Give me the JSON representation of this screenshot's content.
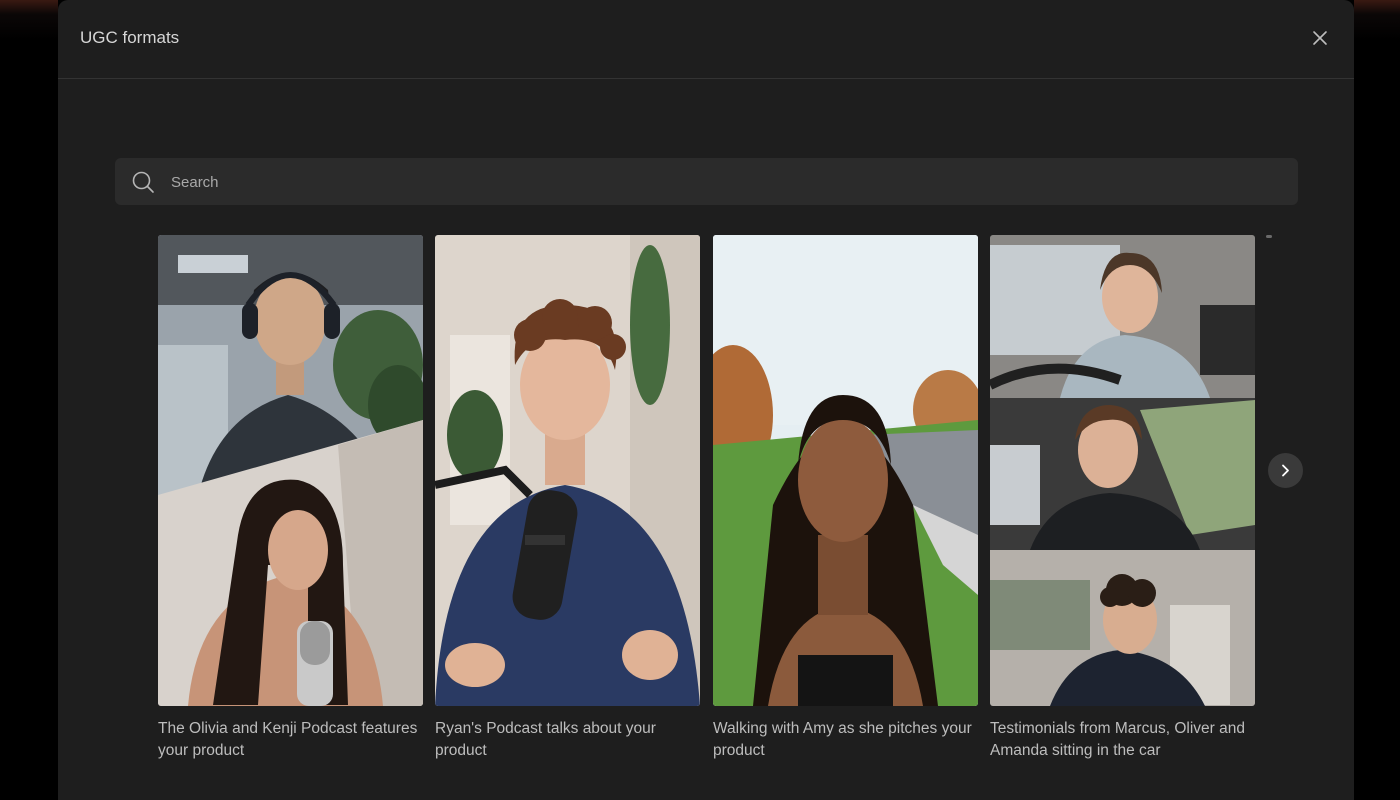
{
  "modal": {
    "title": "UGC formats",
    "close_icon": "close-icon"
  },
  "search": {
    "placeholder": "Search",
    "value": "",
    "icon": "search-icon"
  },
  "carousel": {
    "next_icon": "chevron-right-icon",
    "cards": [
      {
        "caption": "The Olivia and Kenji Podcast features your product"
      },
      {
        "caption": "Ryan's Podcast talks about your product"
      },
      {
        "caption": "Walking with Amy as she pitches your product"
      },
      {
        "caption": "Testimonials from Marcus, Oliver and Amanda sitting in the car"
      }
    ]
  },
  "colors": {
    "backdrop": "#000000",
    "modal_bg": "#1e1e1e",
    "search_bg": "#2b2b2b",
    "text_primary": "#d6d6d6",
    "text_caption": "#bdbdbd"
  }
}
